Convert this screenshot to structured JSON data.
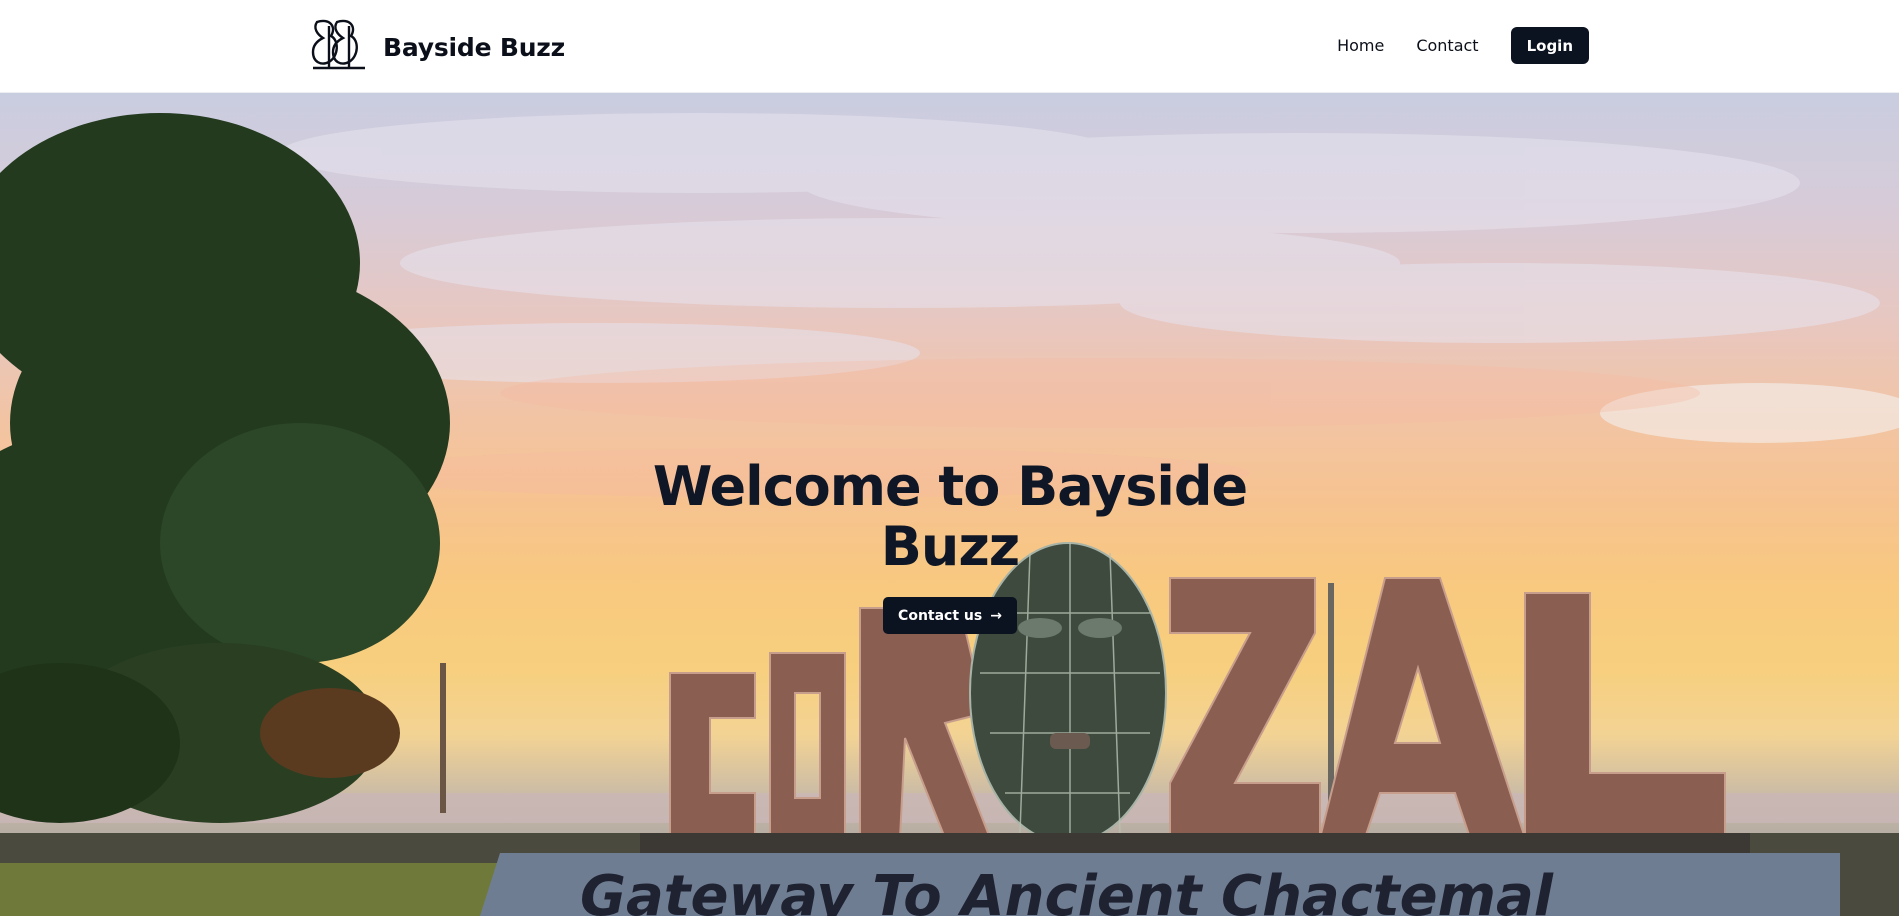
{
  "header": {
    "brand_name": "Bayside Buzz",
    "nav": {
      "home": "Home",
      "contact": "Contact",
      "login": "Login"
    }
  },
  "hero": {
    "title": "Welcome to Bayside Buzz",
    "cta_label": "Contact us",
    "cta_icon": "→",
    "photo": {
      "sign_letters": "COROZAL",
      "plaque_text": "Gateway To Ancient Chactemal"
    }
  },
  "colors": {
    "primary_dark": "#0b1220",
    "text": "#0f1626",
    "header_bg": "#ffffff"
  }
}
